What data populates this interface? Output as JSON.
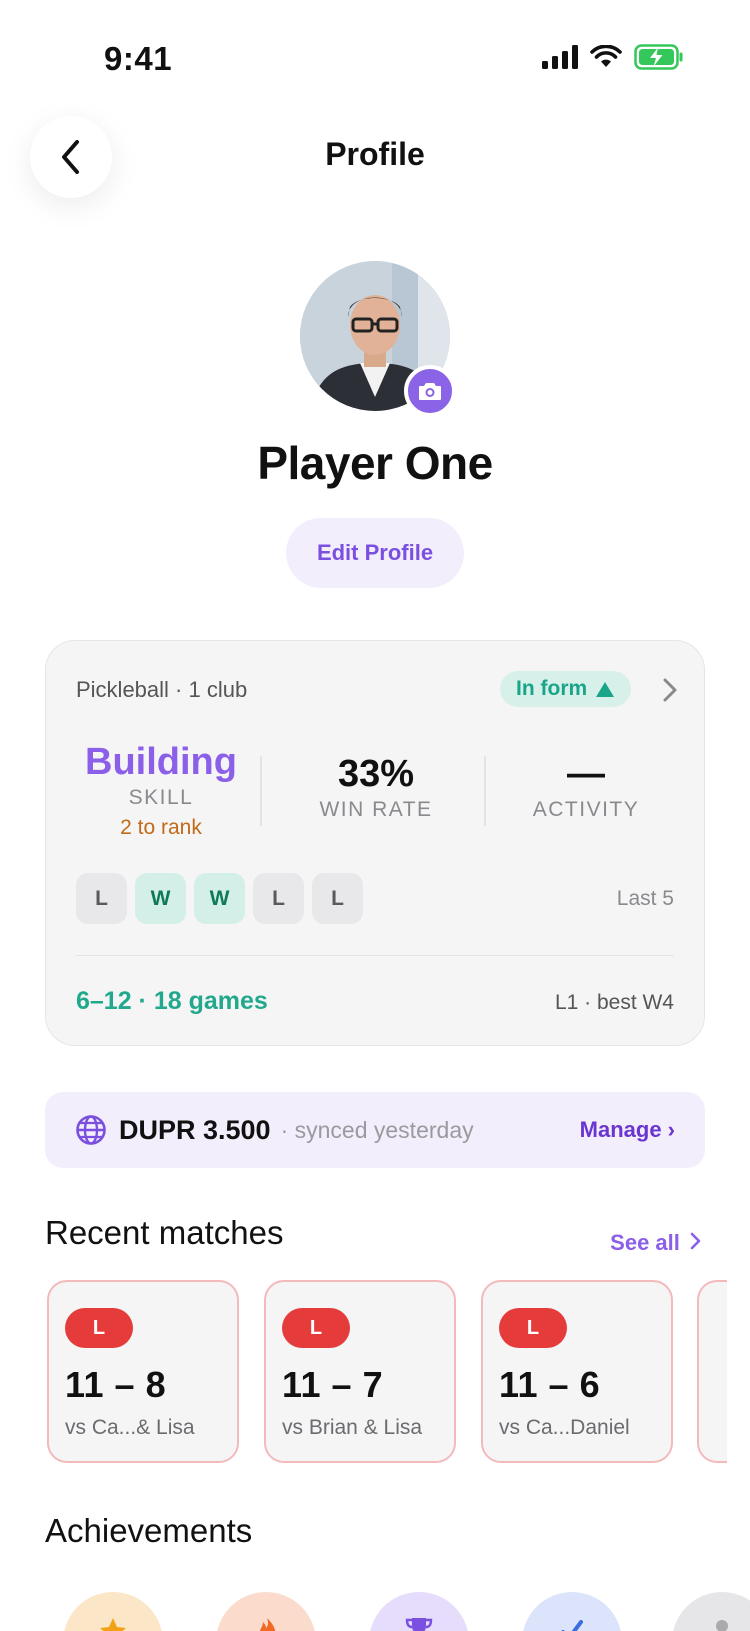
{
  "status_bar": {
    "time": "9:41"
  },
  "header": {
    "title": "Profile"
  },
  "profile": {
    "name": "Player One",
    "edit_label": "Edit Profile"
  },
  "stats": {
    "subtitle": "Pickleball · 1 club",
    "form_badge": "In form",
    "skill": {
      "value": "Building",
      "label": "SKILL",
      "note": "2 to rank"
    },
    "win_rate": {
      "value": "33%",
      "label": "WIN RATE"
    },
    "activity": {
      "value": "—",
      "label": "ACTIVITY"
    },
    "recent_results": [
      "L",
      "W",
      "W",
      "L",
      "L"
    ],
    "recent_label": "Last 5",
    "record": "6–12 · 18 games",
    "streak": "L1 · best W4"
  },
  "dupr": {
    "rating": "DUPR 3.500",
    "sync": "· synced yesterday",
    "manage": "Manage ›"
  },
  "recent_matches": {
    "title": "Recent matches",
    "see_all": "See all",
    "items": [
      {
        "result": "L",
        "score": "11 – 8",
        "opponents": "vs Ca...& Lisa"
      },
      {
        "result": "L",
        "score": "11 – 7",
        "opponents": "vs Brian & Lisa"
      },
      {
        "result": "L",
        "score": "11 – 6",
        "opponents": "vs Ca...Daniel"
      }
    ]
  },
  "achievements": {
    "title": "Achievements",
    "badges": [
      {
        "icon": "star-icon",
        "color": "#fbe6c8"
      },
      {
        "icon": "flame-icon",
        "color": "#fbdccc"
      },
      {
        "icon": "trophy-icon",
        "color": "#e6dcfb"
      },
      {
        "icon": "check-icon",
        "color": "#dbe4fb"
      },
      {
        "icon": "person-icon",
        "color": "#e6e6e8"
      }
    ]
  },
  "colors": {
    "accent": "#8b5fe8",
    "win": "#0f7a5a",
    "loss": "#e53b3b",
    "teal": "#22a88c"
  }
}
